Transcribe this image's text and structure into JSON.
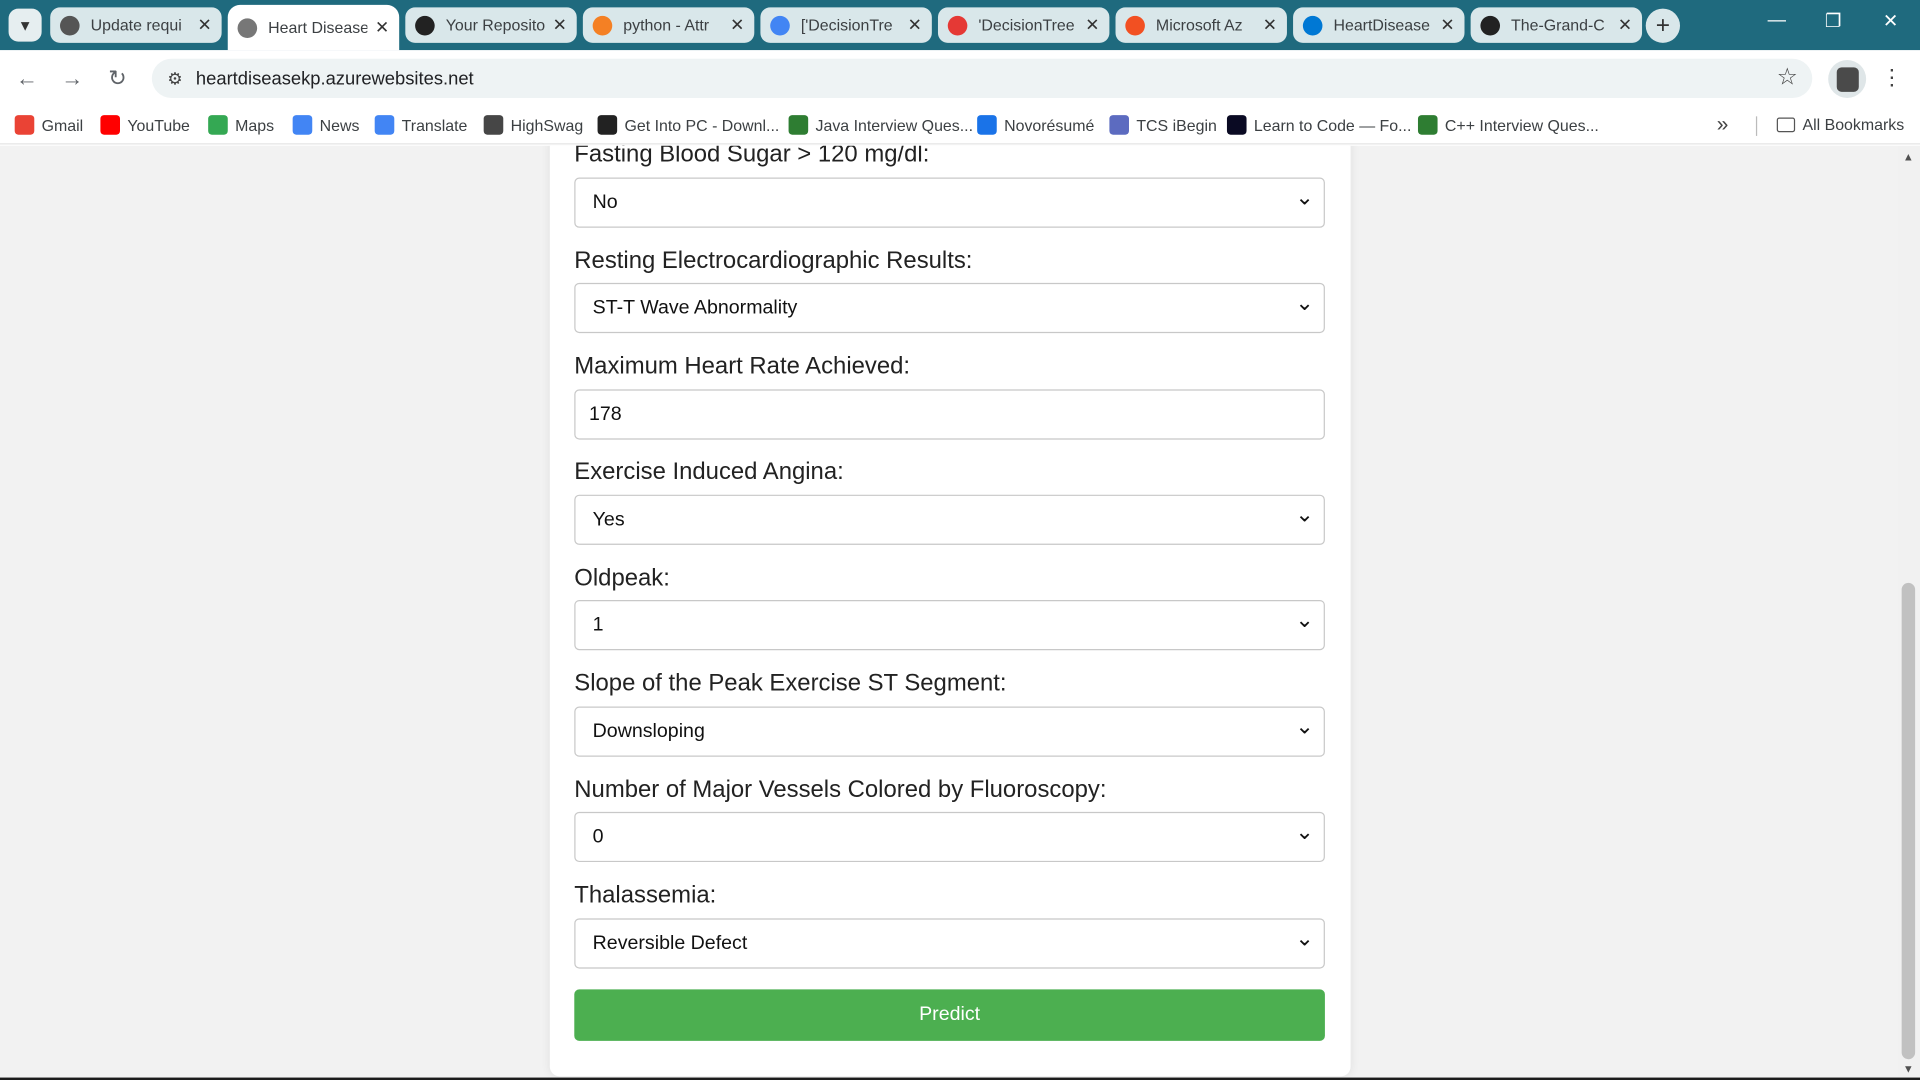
{
  "browser": {
    "tabs": [
      {
        "title": "Update requi",
        "icon": "github-icon",
        "color": "#555555",
        "active": false
      },
      {
        "title": "Heart Disease",
        "icon": "globe-icon",
        "color": "#777777",
        "active": true
      },
      {
        "title": "Your Reposito",
        "icon": "github-icon",
        "color": "#222222",
        "active": false
      },
      {
        "title": "python - Attr",
        "icon": "stackoverflow-icon",
        "color": "#f48024",
        "active": false
      },
      {
        "title": "['DecisionTre",
        "icon": "google-icon",
        "color": "#4285f4",
        "active": false
      },
      {
        "title": "'DecisionTree",
        "icon": "crown-icon",
        "color": "#e53935",
        "active": false
      },
      {
        "title": "Microsoft Az",
        "icon": "microsoft-icon",
        "color": "#f25022",
        "active": false
      },
      {
        "title": "HeartDisease",
        "icon": "azure-icon",
        "color": "#0078d4",
        "active": false
      },
      {
        "title": "The-Grand-C",
        "icon": "github-icon",
        "color": "#222222",
        "active": false
      }
    ],
    "new_tab_label": "+",
    "address": "heartdiseasekp.azurewebsites.net",
    "bookmarks": [
      {
        "label": "Gmail",
        "icon": "gmail-icon",
        "color": "#ea4335"
      },
      {
        "label": "YouTube",
        "icon": "youtube-icon",
        "color": "#ff0000"
      },
      {
        "label": "Maps",
        "icon": "maps-icon",
        "color": "#34a853"
      },
      {
        "label": "News",
        "icon": "news-icon",
        "color": "#4285f4"
      },
      {
        "label": "Translate",
        "icon": "translate-icon",
        "color": "#4285f4"
      },
      {
        "label": "HighSwag",
        "icon": "wordpress-icon",
        "color": "#464646"
      },
      {
        "label": "Get Into PC - Downl...",
        "icon": "getintopc-icon",
        "color": "#222222"
      },
      {
        "label": "Java Interview Ques...",
        "icon": "interview-icon",
        "color": "#2e7d32"
      },
      {
        "label": "Novorésumé",
        "icon": "novoresume-icon",
        "color": "#1a73e8"
      },
      {
        "label": "TCS iBegin",
        "icon": "tcs-icon",
        "color": "#5c6bc0"
      },
      {
        "label": "Learn to Code — Fo...",
        "icon": "freecodecamp-icon",
        "color": "#0a0a23"
      },
      {
        "label": "C++ Interview Ques...",
        "icon": "interview-icon",
        "color": "#2e7d32"
      }
    ],
    "all_bookmarks_label": "All Bookmarks"
  },
  "form": {
    "fields": [
      {
        "label": "Fasting Blood Sugar > 120 mg/dl:",
        "value": "No",
        "type": "select"
      },
      {
        "label": "Resting Electrocardiographic Results:",
        "value": "ST-T Wave Abnormality",
        "type": "select"
      },
      {
        "label": "Maximum Heart Rate Achieved:",
        "value": "178",
        "type": "input"
      },
      {
        "label": "Exercise Induced Angina:",
        "value": "Yes",
        "type": "select"
      },
      {
        "label": "Oldpeak:",
        "value": "1",
        "type": "select"
      },
      {
        "label": "Slope of the Peak Exercise ST Segment:",
        "value": "Downsloping",
        "type": "select"
      },
      {
        "label": "Number of Major Vessels Colored by Fluoroscopy:",
        "value": "0",
        "type": "select"
      },
      {
        "label": "Thalassemia:",
        "value": "Reversible Defect",
        "type": "select"
      }
    ],
    "submit_label": "Predict",
    "submit_color": "#4caf50"
  }
}
